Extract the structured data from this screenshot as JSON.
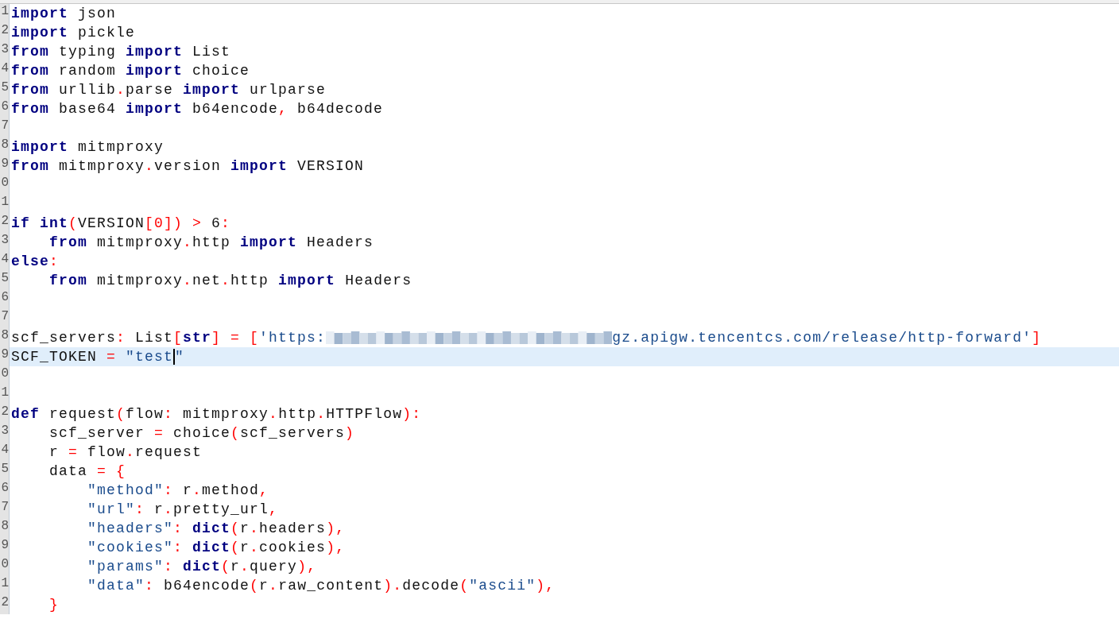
{
  "editor": {
    "lines": [
      {
        "number": "1",
        "current": false,
        "tokens": [
          {
            "kind": "kw",
            "text": "import"
          },
          {
            "kind": "plain",
            "text": " json"
          }
        ]
      },
      {
        "number": "2",
        "current": false,
        "tokens": [
          {
            "kind": "kw",
            "text": "import"
          },
          {
            "kind": "plain",
            "text": " pickle"
          }
        ]
      },
      {
        "number": "3",
        "current": false,
        "tokens": [
          {
            "kind": "kw",
            "text": "from"
          },
          {
            "kind": "plain",
            "text": " typing "
          },
          {
            "kind": "kw",
            "text": "import"
          },
          {
            "kind": "plain",
            "text": " List"
          }
        ]
      },
      {
        "number": "4",
        "current": false,
        "tokens": [
          {
            "kind": "kw",
            "text": "from"
          },
          {
            "kind": "plain",
            "text": " random "
          },
          {
            "kind": "kw",
            "text": "import"
          },
          {
            "kind": "plain",
            "text": " choice"
          }
        ]
      },
      {
        "number": "5",
        "current": false,
        "tokens": [
          {
            "kind": "kw",
            "text": "from"
          },
          {
            "kind": "plain",
            "text": " urllib"
          },
          {
            "kind": "op",
            "text": "."
          },
          {
            "kind": "plain",
            "text": "parse "
          },
          {
            "kind": "kw",
            "text": "import"
          },
          {
            "kind": "plain",
            "text": " urlparse"
          }
        ]
      },
      {
        "number": "6",
        "current": false,
        "tokens": [
          {
            "kind": "kw",
            "text": "from"
          },
          {
            "kind": "plain",
            "text": " base64 "
          },
          {
            "kind": "kw",
            "text": "import"
          },
          {
            "kind": "plain",
            "text": " b64encode"
          },
          {
            "kind": "op",
            "text": ","
          },
          {
            "kind": "plain",
            "text": " b64decode"
          }
        ]
      },
      {
        "number": "7",
        "current": false
      },
      {
        "number": "8",
        "current": false,
        "tokens": [
          {
            "kind": "kw",
            "text": "import"
          },
          {
            "kind": "plain",
            "text": " mitmproxy"
          }
        ]
      },
      {
        "number": "9",
        "current": false,
        "tokens": [
          {
            "kind": "kw",
            "text": "from"
          },
          {
            "kind": "plain",
            "text": " mitmproxy"
          },
          {
            "kind": "op",
            "text": "."
          },
          {
            "kind": "plain",
            "text": "version "
          },
          {
            "kind": "kw",
            "text": "import"
          },
          {
            "kind": "plain",
            "text": " VERSION"
          }
        ]
      },
      {
        "number": "0",
        "current": false
      },
      {
        "number": "1",
        "current": false
      },
      {
        "number": "2",
        "current": false,
        "tokens": [
          {
            "kind": "kw",
            "text": "if"
          },
          {
            "kind": "kw",
            "text": " int"
          },
          {
            "kind": "op",
            "text": "("
          },
          {
            "kind": "plain",
            "text": "VERSION"
          },
          {
            "kind": "op",
            "text": "[0]) >"
          },
          {
            "kind": "plain",
            "text": " 6"
          },
          {
            "kind": "op",
            "text": ":"
          }
        ]
      },
      {
        "number": "3",
        "current": false,
        "tokens": [
          {
            "kind": "kw",
            "text": "    from"
          },
          {
            "kind": "plain",
            "text": " mitmproxy"
          },
          {
            "kind": "op",
            "text": "."
          },
          {
            "kind": "plain",
            "text": "http "
          },
          {
            "kind": "kw",
            "text": "import"
          },
          {
            "kind": "plain",
            "text": " Headers"
          }
        ]
      },
      {
        "number": "4",
        "current": false,
        "tokens": [
          {
            "kind": "kw",
            "text": "else"
          },
          {
            "kind": "op",
            "text": ":"
          }
        ]
      },
      {
        "number": "5",
        "current": false,
        "tokens": [
          {
            "kind": "kw",
            "text": "    from"
          },
          {
            "kind": "plain",
            "text": " mitmproxy"
          },
          {
            "kind": "op",
            "text": "."
          },
          {
            "kind": "plain",
            "text": "net"
          },
          {
            "kind": "op",
            "text": "."
          },
          {
            "kind": "plain",
            "text": "http "
          },
          {
            "kind": "kw",
            "text": "import"
          },
          {
            "kind": "plain",
            "text": " Headers"
          }
        ]
      },
      {
        "number": "6",
        "current": false
      },
      {
        "number": "7",
        "current": false
      },
      {
        "number": "8",
        "current": false,
        "tokens": [
          {
            "kind": "plain",
            "text": "scf_servers"
          },
          {
            "kind": "op",
            "text": ":"
          },
          {
            "kind": "plain",
            "text": " List"
          },
          {
            "kind": "op",
            "text": "["
          },
          {
            "kind": "kw",
            "text": "str"
          },
          {
            "kind": "op",
            "text": "] = ["
          },
          {
            "kind": "str",
            "text": "'https:"
          },
          {
            "kind": "redacted"
          },
          {
            "kind": "str",
            "text": "gz.apigw.tencentcs.com/release/http-forward'"
          },
          {
            "kind": "op",
            "text": "]"
          }
        ]
      },
      {
        "number": "9",
        "current": true,
        "tokens": [
          {
            "kind": "plain",
            "text": "SCF_TOKEN"
          },
          {
            "kind": "op",
            "text": " = "
          },
          {
            "kind": "str",
            "text": "\"test"
          },
          {
            "kind": "caret"
          },
          {
            "kind": "str",
            "text": "\""
          }
        ]
      },
      {
        "number": "0",
        "current": false
      },
      {
        "number": "1",
        "current": false
      },
      {
        "number": "2",
        "current": false,
        "tokens": [
          {
            "kind": "kw",
            "text": "def"
          },
          {
            "kind": "plain",
            "text": " request"
          },
          {
            "kind": "op",
            "text": "("
          },
          {
            "kind": "plain",
            "text": "flow"
          },
          {
            "kind": "op",
            "text": ":"
          },
          {
            "kind": "plain",
            "text": " mitmproxy"
          },
          {
            "kind": "op",
            "text": "."
          },
          {
            "kind": "plain",
            "text": "http"
          },
          {
            "kind": "op",
            "text": "."
          },
          {
            "kind": "plain",
            "text": "HTTPFlow"
          },
          {
            "kind": "op",
            "text": "):"
          }
        ]
      },
      {
        "number": "3",
        "current": false,
        "tokens": [
          {
            "kind": "plain",
            "text": "    scf_server"
          },
          {
            "kind": "op",
            "text": " = "
          },
          {
            "kind": "plain",
            "text": "choice"
          },
          {
            "kind": "op",
            "text": "("
          },
          {
            "kind": "plain",
            "text": "scf_servers"
          },
          {
            "kind": "op",
            "text": ")"
          }
        ]
      },
      {
        "number": "4",
        "current": false,
        "tokens": [
          {
            "kind": "plain",
            "text": "    r"
          },
          {
            "kind": "op",
            "text": " = "
          },
          {
            "kind": "plain",
            "text": "flow"
          },
          {
            "kind": "op",
            "text": "."
          },
          {
            "kind": "plain",
            "text": "request"
          }
        ]
      },
      {
        "number": "5",
        "current": false,
        "tokens": [
          {
            "kind": "plain",
            "text": "    data"
          },
          {
            "kind": "op",
            "text": " = {"
          }
        ]
      },
      {
        "number": "6",
        "current": false,
        "tokens": [
          {
            "kind": "str",
            "text": "        \"method\""
          },
          {
            "kind": "op",
            "text": ":"
          },
          {
            "kind": "plain",
            "text": " r"
          },
          {
            "kind": "op",
            "text": "."
          },
          {
            "kind": "plain",
            "text": "method"
          },
          {
            "kind": "op",
            "text": ","
          }
        ]
      },
      {
        "number": "7",
        "current": false,
        "tokens": [
          {
            "kind": "str",
            "text": "        \"url\""
          },
          {
            "kind": "op",
            "text": ":"
          },
          {
            "kind": "plain",
            "text": " r"
          },
          {
            "kind": "op",
            "text": "."
          },
          {
            "kind": "plain",
            "text": "pretty_url"
          },
          {
            "kind": "op",
            "text": ","
          }
        ]
      },
      {
        "number": "8",
        "current": false,
        "tokens": [
          {
            "kind": "str",
            "text": "        \"headers\""
          },
          {
            "kind": "op",
            "text": ":"
          },
          {
            "kind": "kw",
            "text": " dict"
          },
          {
            "kind": "op",
            "text": "("
          },
          {
            "kind": "plain",
            "text": "r"
          },
          {
            "kind": "op",
            "text": "."
          },
          {
            "kind": "plain",
            "text": "headers"
          },
          {
            "kind": "op",
            "text": "),"
          }
        ]
      },
      {
        "number": "9",
        "current": false,
        "tokens": [
          {
            "kind": "str",
            "text": "        \"cookies\""
          },
          {
            "kind": "op",
            "text": ":"
          },
          {
            "kind": "kw",
            "text": " dict"
          },
          {
            "kind": "op",
            "text": "("
          },
          {
            "kind": "plain",
            "text": "r"
          },
          {
            "kind": "op",
            "text": "."
          },
          {
            "kind": "plain",
            "text": "cookies"
          },
          {
            "kind": "op",
            "text": "),"
          }
        ]
      },
      {
        "number": "0",
        "current": false,
        "tokens": [
          {
            "kind": "str",
            "text": "        \"params\""
          },
          {
            "kind": "op",
            "text": ":"
          },
          {
            "kind": "kw",
            "text": " dict"
          },
          {
            "kind": "op",
            "text": "("
          },
          {
            "kind": "plain",
            "text": "r"
          },
          {
            "kind": "op",
            "text": "."
          },
          {
            "kind": "plain",
            "text": "query"
          },
          {
            "kind": "op",
            "text": "),"
          }
        ]
      },
      {
        "number": "1",
        "current": false,
        "tokens": [
          {
            "kind": "str",
            "text": "        \"data\""
          },
          {
            "kind": "op",
            "text": ":"
          },
          {
            "kind": "plain",
            "text": " b64encode"
          },
          {
            "kind": "op",
            "text": "("
          },
          {
            "kind": "plain",
            "text": "r"
          },
          {
            "kind": "op",
            "text": "."
          },
          {
            "kind": "plain",
            "text": "raw_content"
          },
          {
            "kind": "op",
            "text": ")."
          },
          {
            "kind": "plain",
            "text": "decode"
          },
          {
            "kind": "op",
            "text": "("
          },
          {
            "kind": "str",
            "text": "\"ascii\""
          },
          {
            "kind": "op",
            "text": "),"
          }
        ]
      },
      {
        "number": "2",
        "current": false,
        "tokens": [
          {
            "kind": "op",
            "text": "    }"
          }
        ]
      }
    ]
  }
}
